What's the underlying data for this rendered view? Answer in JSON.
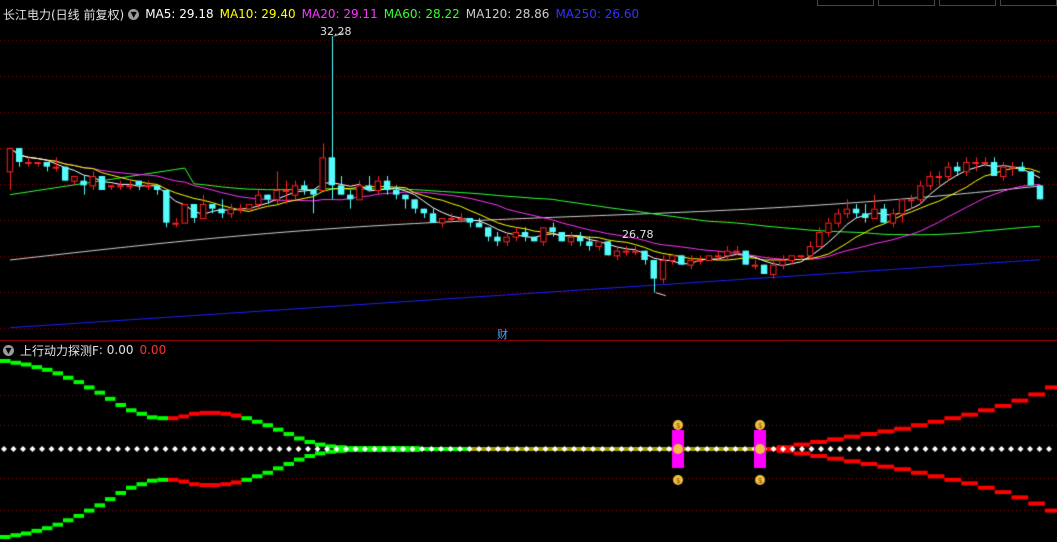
{
  "main_panel": {
    "title": "长江电力(日线 前复权)",
    "ma": [
      {
        "label": "MA5: 29.18",
        "color": "#ffffff"
      },
      {
        "label": "MA10: 29.40",
        "color": "#ffff00"
      },
      {
        "label": "MA20: 29.11",
        "color": "#ff33ff"
      },
      {
        "label": "MA60: 28.22",
        "color": "#33ff33"
      },
      {
        "label": "MA120: 28.86",
        "color": "#cccccc"
      },
      {
        "label": "MA250: 26.60",
        "color": "#3333ff"
      }
    ],
    "high_label": "32.28",
    "low_label": "26.78",
    "finance_marker": "财"
  },
  "indicator_panel": {
    "title": "上行动力探测F",
    "value1": ": 0.00",
    "value2": "0.00",
    "value2_color": "#ff3333"
  },
  "colors": {
    "up": "#ff2020",
    "down": "#54fcfc",
    "grid": "#800000",
    "dot": "#ffffff",
    "green_bar": "#00ff00",
    "red_bar": "#ff0000",
    "signal": "#ff00ff"
  },
  "chart_data": {
    "type": "candlestick",
    "price_range": [
      26.0,
      32.6
    ],
    "candles": [
      [
        29.4,
        29.9,
        29.0,
        29.9
      ],
      [
        29.9,
        29.9,
        29.5,
        29.6
      ],
      [
        29.6,
        29.7,
        29.5,
        29.6
      ],
      [
        29.6,
        29.6,
        29.5,
        29.6
      ],
      [
        29.6,
        29.6,
        29.4,
        29.5
      ],
      [
        29.5,
        29.7,
        29.4,
        29.5
      ],
      [
        29.5,
        29.5,
        29.2,
        29.2
      ],
      [
        29.2,
        29.3,
        29.1,
        29.3
      ],
      [
        29.2,
        29.3,
        28.9,
        29.1
      ],
      [
        29.1,
        29.4,
        29.0,
        29.3
      ],
      [
        29.3,
        29.3,
        29.0,
        29.0
      ],
      [
        29.1,
        29.1,
        29.0,
        29.1
      ],
      [
        29.1,
        29.2,
        29.0,
        29.1
      ],
      [
        29.1,
        29.2,
        29.0,
        29.1
      ],
      [
        29.2,
        29.2,
        29.0,
        29.1
      ],
      [
        29.1,
        29.2,
        29.0,
        29.1
      ],
      [
        29.1,
        29.1,
        28.9,
        29.0
      ],
      [
        29.0,
        29.0,
        28.2,
        28.3
      ],
      [
        28.3,
        28.4,
        28.2,
        28.3
      ],
      [
        28.3,
        28.7,
        28.3,
        28.7
      ],
      [
        28.7,
        28.7,
        28.3,
        28.4
      ],
      [
        28.4,
        28.9,
        28.4,
        28.7
      ],
      [
        28.7,
        28.7,
        28.5,
        28.6
      ],
      [
        28.6,
        28.8,
        28.4,
        28.5
      ],
      [
        28.5,
        28.7,
        28.4,
        28.6
      ],
      [
        28.6,
        28.7,
        28.5,
        28.6
      ],
      [
        28.6,
        28.7,
        28.6,
        28.7
      ],
      [
        28.7,
        29.0,
        28.6,
        28.9
      ],
      [
        28.9,
        28.9,
        28.7,
        28.8
      ],
      [
        28.8,
        29.4,
        28.7,
        29.0
      ],
      [
        29.0,
        29.2,
        28.7,
        29.0
      ],
      [
        28.9,
        29.2,
        28.8,
        29.1
      ],
      [
        29.1,
        29.2,
        28.9,
        29.0
      ],
      [
        29.0,
        29.0,
        28.5,
        28.9
      ],
      [
        29.0,
        30.0,
        29.0,
        29.7
      ],
      [
        29.7,
        32.3,
        28.8,
        29.1
      ],
      [
        29.1,
        29.3,
        28.9,
        28.9
      ],
      [
        28.9,
        29.0,
        28.6,
        28.8
      ],
      [
        28.8,
        29.2,
        28.8,
        29.1
      ],
      [
        29.1,
        29.3,
        29.0,
        29.0
      ],
      [
        29.0,
        29.3,
        28.9,
        29.2
      ],
      [
        29.2,
        29.3,
        28.9,
        29.0
      ],
      [
        29.0,
        29.1,
        28.8,
        28.9
      ],
      [
        28.9,
        28.9,
        28.6,
        28.8
      ],
      [
        28.8,
        28.8,
        28.5,
        28.6
      ],
      [
        28.6,
        28.6,
        28.4,
        28.5
      ],
      [
        28.5,
        28.6,
        28.3,
        28.3
      ],
      [
        28.3,
        28.4,
        28.2,
        28.4
      ],
      [
        28.4,
        28.5,
        28.3,
        28.4
      ],
      [
        28.4,
        28.5,
        28.3,
        28.4
      ],
      [
        28.4,
        28.4,
        28.2,
        28.3
      ],
      [
        28.3,
        28.4,
        28.2,
        28.2
      ],
      [
        28.2,
        28.2,
        27.9,
        28.0
      ],
      [
        28.0,
        28.1,
        27.8,
        27.9
      ],
      [
        27.9,
        28.1,
        27.8,
        28.0
      ],
      [
        28.0,
        28.2,
        27.9,
        28.1
      ],
      [
        28.1,
        28.2,
        27.9,
        28.0
      ],
      [
        28.0,
        28.0,
        27.9,
        27.9
      ],
      [
        27.9,
        28.2,
        27.8,
        28.2
      ],
      [
        28.2,
        28.3,
        28.0,
        28.1
      ],
      [
        28.1,
        28.1,
        27.9,
        27.9
      ],
      [
        27.9,
        28.1,
        27.8,
        28.0
      ],
      [
        28.0,
        28.1,
        27.8,
        27.9
      ],
      [
        27.9,
        28.0,
        27.7,
        27.8
      ],
      [
        27.8,
        27.9,
        27.7,
        27.9
      ],
      [
        27.9,
        27.9,
        27.6,
        27.6
      ],
      [
        27.6,
        27.8,
        27.5,
        27.7
      ],
      [
        27.7,
        27.8,
        27.6,
        27.7
      ],
      [
        27.7,
        27.8,
        27.6,
        27.7
      ],
      [
        27.7,
        27.7,
        27.4,
        27.5
      ],
      [
        27.5,
        27.5,
        26.8,
        27.1
      ],
      [
        27.1,
        27.6,
        27.0,
        27.5
      ],
      [
        27.5,
        27.6,
        27.4,
        27.6
      ],
      [
        27.6,
        27.6,
        27.4,
        27.4
      ],
      [
        27.4,
        27.6,
        27.3,
        27.5
      ],
      [
        27.5,
        27.6,
        27.4,
        27.5
      ],
      [
        27.5,
        27.6,
        27.5,
        27.6
      ],
      [
        27.6,
        27.7,
        27.5,
        27.6
      ],
      [
        27.6,
        27.8,
        27.5,
        27.7
      ],
      [
        27.7,
        27.8,
        27.6,
        27.7
      ],
      [
        27.7,
        27.7,
        27.4,
        27.4
      ],
      [
        27.4,
        27.5,
        27.3,
        27.4
      ],
      [
        27.4,
        27.4,
        27.2,
        27.2
      ],
      [
        27.2,
        27.5,
        27.1,
        27.4
      ],
      [
        27.4,
        27.6,
        27.3,
        27.5
      ],
      [
        27.5,
        27.6,
        27.4,
        27.6
      ],
      [
        27.6,
        27.6,
        27.5,
        27.6
      ],
      [
        27.6,
        27.9,
        27.5,
        27.8
      ],
      [
        27.8,
        28.2,
        27.8,
        28.1
      ],
      [
        28.1,
        28.4,
        28.0,
        28.3
      ],
      [
        28.3,
        28.6,
        28.2,
        28.5
      ],
      [
        28.5,
        28.8,
        28.4,
        28.6
      ],
      [
        28.6,
        28.7,
        28.4,
        28.5
      ],
      [
        28.5,
        28.7,
        28.3,
        28.4
      ],
      [
        28.4,
        28.9,
        28.4,
        28.6
      ],
      [
        28.6,
        28.7,
        28.3,
        28.3
      ],
      [
        28.3,
        28.6,
        28.2,
        28.5
      ],
      [
        28.5,
        28.8,
        28.3,
        28.8
      ],
      [
        28.8,
        28.9,
        28.6,
        28.8
      ],
      [
        28.8,
        29.2,
        28.7,
        29.1
      ],
      [
        29.1,
        29.4,
        29.0,
        29.3
      ],
      [
        29.3,
        29.4,
        29.1,
        29.3
      ],
      [
        29.3,
        29.6,
        29.2,
        29.5
      ],
      [
        29.5,
        29.6,
        29.3,
        29.4
      ],
      [
        29.4,
        29.7,
        29.3,
        29.6
      ],
      [
        29.6,
        29.7,
        29.4,
        29.6
      ],
      [
        29.6,
        29.7,
        29.5,
        29.6
      ],
      [
        29.6,
        29.7,
        29.3,
        29.3
      ],
      [
        29.3,
        29.6,
        29.2,
        29.5
      ],
      [
        29.5,
        29.6,
        29.3,
        29.5
      ],
      [
        29.5,
        29.6,
        29.4,
        29.4
      ],
      [
        29.4,
        29.4,
        29.1,
        29.1
      ],
      [
        29.1,
        29.1,
        28.8,
        28.8
      ]
    ],
    "indicator": {
      "green_top": [
        1.0,
        0.98,
        0.96,
        0.93,
        0.9,
        0.86,
        0.81,
        0.76,
        0.7,
        0.64,
        0.57,
        0.5,
        0.44,
        0.4,
        0.36,
        0.35,
        0.35,
        0.37,
        0.4,
        0.41,
        0.41,
        0.4,
        0.38,
        0.35,
        0.31,
        0.27,
        0.22,
        0.17,
        0.12,
        0.08,
        0.05,
        0.03,
        0.02,
        0.01,
        0.01,
        0.01,
        0.01,
        0.01,
        0.01,
        0.01,
        0.0,
        0.0,
        0.0,
        0.0,
        0.0
      ],
      "red_tail": [
        0.0,
        0.02,
        0.05,
        0.08,
        0.11,
        0.14,
        0.17,
        0.2,
        0.23,
        0.27,
        0.31,
        0.35,
        0.39,
        0.44,
        0.49,
        0.55,
        0.62,
        0.7
      ]
    }
  }
}
